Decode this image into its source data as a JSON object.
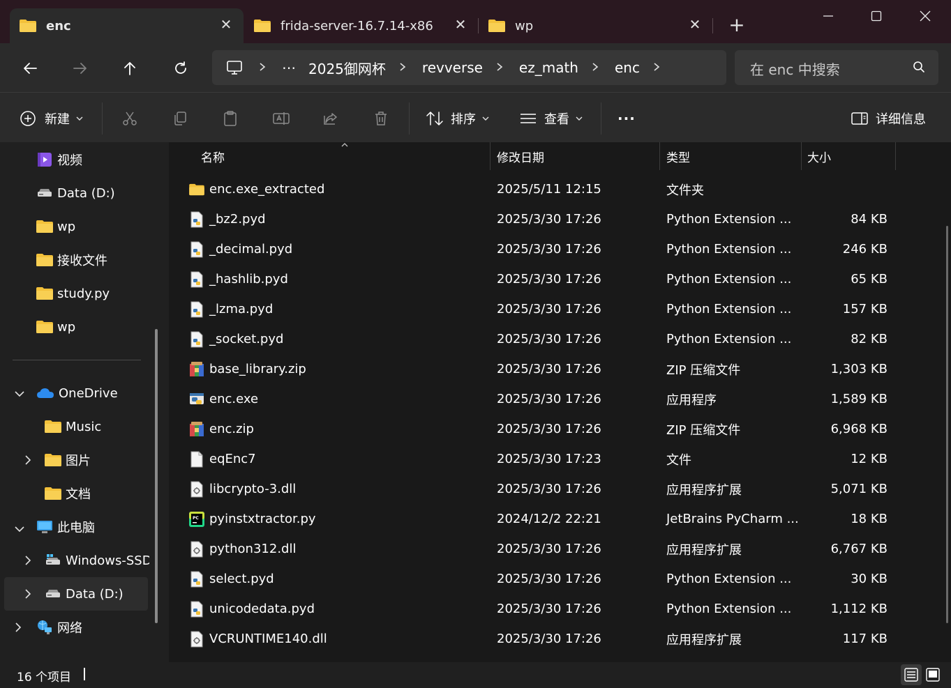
{
  "colors": {
    "folder": "#f3c13a",
    "accent": "#4cc2ff",
    "onedrive": "#2d8cf0"
  },
  "tabs": [
    {
      "label": "enc",
      "icon": "folder-icon",
      "active": true
    },
    {
      "label": "frida-server-16.7.14-x86",
      "icon": "folder-icon",
      "active": false
    },
    {
      "label": "wp",
      "icon": "folder-icon",
      "active": false
    }
  ],
  "address": {
    "overflow": "⋯",
    "crumbs": [
      "2025御网杯",
      "revverse",
      "ez_math",
      "enc"
    ]
  },
  "search": {
    "placeholder": "在 enc 中搜索"
  },
  "toolbar": {
    "new_label": "新建",
    "sort_label": "排序",
    "view_label": "查看",
    "more_label": "···",
    "details_label": "详细信息"
  },
  "sidebar": {
    "quick_access": [
      {
        "label": "视频",
        "icon": "video-icon",
        "pinned": true
      },
      {
        "label": "Data (D:)",
        "icon": "drive-icon",
        "pinned": true
      },
      {
        "label": "wp",
        "icon": "folder-icon",
        "pinned": true
      },
      {
        "label": "接收文件",
        "icon": "folder-icon",
        "pinned": true
      },
      {
        "label": "study.py",
        "icon": "folder-icon",
        "pinned": true
      },
      {
        "label": "wp",
        "icon": "folder-icon",
        "pinned": true
      }
    ],
    "tree": [
      {
        "label": "OneDrive",
        "icon": "onedrive-icon",
        "expander": "expanded"
      },
      {
        "label": "Music",
        "icon": "folder-icon",
        "expander": "none"
      },
      {
        "label": "图片",
        "icon": "folder-icon",
        "expander": "collapsed"
      },
      {
        "label": "文档",
        "icon": "folder-icon",
        "expander": "none"
      },
      {
        "label": "此电脑",
        "icon": "computer-icon",
        "expander": "expanded"
      },
      {
        "label": "Windows-SSD",
        "icon": "drive-icon",
        "expander": "collapsed"
      },
      {
        "label": "Data (D:)",
        "icon": "drive-icon",
        "expander": "collapsed",
        "selected": true
      },
      {
        "label": "网络",
        "icon": "network-icon",
        "expander": "collapsed"
      }
    ]
  },
  "columns": {
    "name": "名称",
    "date": "修改日期",
    "type": "类型",
    "size": "大小"
  },
  "files": [
    {
      "name": "enc.exe_extracted",
      "date": "2025/5/11 12:15",
      "type": "文件夹",
      "size": "",
      "icon": "folder-icon"
    },
    {
      "name": "_bz2.pyd",
      "date": "2025/3/30 17:26",
      "type": "Python Extension ...",
      "size": "84 KB",
      "icon": "python-file-icon"
    },
    {
      "name": "_decimal.pyd",
      "date": "2025/3/30 17:26",
      "type": "Python Extension ...",
      "size": "246 KB",
      "icon": "python-file-icon"
    },
    {
      "name": "_hashlib.pyd",
      "date": "2025/3/30 17:26",
      "type": "Python Extension ...",
      "size": "65 KB",
      "icon": "python-file-icon"
    },
    {
      "name": "_lzma.pyd",
      "date": "2025/3/30 17:26",
      "type": "Python Extension ...",
      "size": "157 KB",
      "icon": "python-file-icon"
    },
    {
      "name": "_socket.pyd",
      "date": "2025/3/30 17:26",
      "type": "Python Extension ...",
      "size": "82 KB",
      "icon": "python-file-icon"
    },
    {
      "name": "base_library.zip",
      "date": "2025/3/30 17:26",
      "type": "ZIP 压缩文件",
      "size": "1,303 KB",
      "icon": "zip-icon"
    },
    {
      "name": "enc.exe",
      "date": "2025/3/30 17:26",
      "type": "应用程序",
      "size": "1,589 KB",
      "icon": "python-exe-icon"
    },
    {
      "name": "enc.zip",
      "date": "2025/3/30 17:26",
      "type": "ZIP 压缩文件",
      "size": "6,968 KB",
      "icon": "zip-icon"
    },
    {
      "name": "eqEnc7",
      "date": "2025/3/30 17:23",
      "type": "文件",
      "size": "12 KB",
      "icon": "blank-file-icon"
    },
    {
      "name": "libcrypto-3.dll",
      "date": "2025/3/30 17:26",
      "type": "应用程序扩展",
      "size": "5,071 KB",
      "icon": "dll-icon"
    },
    {
      "name": "pyinstxtractor.py",
      "date": "2024/12/2 22:21",
      "type": "JetBrains PyCharm ...",
      "size": "18 KB",
      "icon": "pycharm-icon"
    },
    {
      "name": "python312.dll",
      "date": "2025/3/30 17:26",
      "type": "应用程序扩展",
      "size": "6,767 KB",
      "icon": "dll-icon"
    },
    {
      "name": "select.pyd",
      "date": "2025/3/30 17:26",
      "type": "Python Extension ...",
      "size": "30 KB",
      "icon": "python-file-icon"
    },
    {
      "name": "unicodedata.pyd",
      "date": "2025/3/30 17:26",
      "type": "Python Extension ...",
      "size": "1,112 KB",
      "icon": "python-file-icon"
    },
    {
      "name": "VCRUNTIME140.dll",
      "date": "2025/3/30 17:26",
      "type": "应用程序扩展",
      "size": "117 KB",
      "icon": "dll-icon"
    }
  ],
  "status": {
    "item_count": "16 个项目"
  }
}
